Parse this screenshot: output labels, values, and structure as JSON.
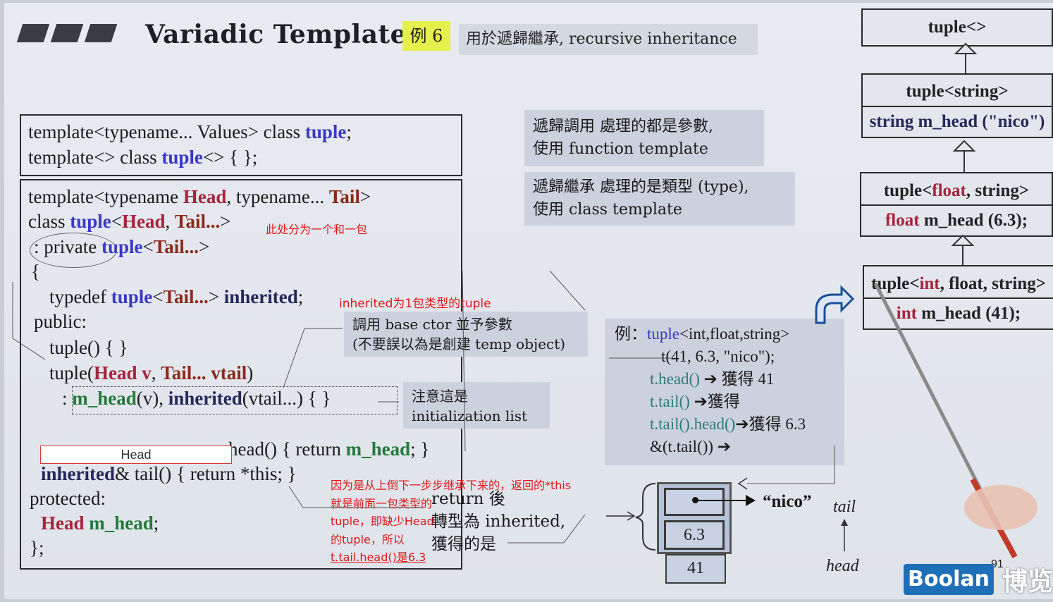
{
  "header": {
    "title": "Variadic Templates",
    "example_tag": "例 6",
    "subtitle": "用於遞歸繼承, recursive inheritance"
  },
  "code_top": {
    "line1": {
      "a": "template<typename... Values> class ",
      "b": "tuple",
      "c": ";"
    },
    "line2": {
      "a": "template<> class ",
      "b": "tuple",
      "c": "<> { };"
    }
  },
  "code_main": {
    "l1": {
      "a": "template<typename ",
      "b": "Head",
      "c": ", typename... ",
      "d": "Tail",
      "e": ">"
    },
    "l2": {
      "a": "class ",
      "b": "tuple",
      "c": "<",
      "d": "Head",
      "e": ", ",
      "f": "Tail...",
      "g": ">"
    },
    "l3": {
      "a": ": private ",
      "b": "tuple",
      "c": "<",
      "d": "Tail...",
      "e": ">"
    },
    "l4": "{",
    "l5": {
      "a": "typedef ",
      "b": "tuple",
      "c": "<",
      "d": "Tail...",
      "e": "> ",
      "f": "inherited",
      "g": ";"
    },
    "l6": "public:",
    "l7": "tuple() { }",
    "l8": {
      "a": "tuple(",
      "b": "Head v",
      "c": ", ",
      "d": "Tail... vtail",
      "e": ")"
    },
    "l9": {
      "a": ": ",
      "b": "m_head",
      "c": "(v), ",
      "d": "inherited",
      "e": "(vtail...) { }"
    },
    "l10": {
      "a": "head() { return ",
      "b": "m_head",
      "c": "; }"
    },
    "l11": {
      "a": "inherited",
      "b": "& ",
      "c": "tail",
      "d": "() { return *this; }"
    },
    "l12": "protected:",
    "l13": {
      "a": "Head",
      "b": " m_head",
      "c": ";"
    },
    "l14": "};"
  },
  "overlay_head": "Head",
  "notes": {
    "split": "此处分为一个和一包",
    "inherited": "inherited为1包类型的tuple",
    "explain_lines": [
      "因为是从上倒下一步步继承下来的，返回的*this",
      "就是前面一包类型的",
      "tuple，即缺少Head",
      "的tuple，所以",
      "t.tail.head()是6.3"
    ]
  },
  "panels": {
    "recursive_call": [
      "遞歸調用 處理的都是參數,",
      "使用 function template"
    ],
    "recursive_inherit": [
      "遞歸繼承 處理的是類型 (type),",
      "使用 class template"
    ],
    "base_ctor": [
      "調用 base ctor 並予參數",
      "(不要誤以為是創建 temp object)"
    ],
    "init_list": [
      "注意這是",
      "initialization list"
    ],
    "return_note": [
      "return 後",
      "轉型為 inherited,",
      "獲得的是"
    ]
  },
  "example": {
    "label": "例：",
    "l1a": "tuple",
    "l1b": "<int,float,string>",
    "l2": "t(41, 6.3, \"nico\");",
    "l3a": "t.head()",
    "l3b": "➔ 獲得 41",
    "l4a": "t.tail()",
    "l4b": "➔獲得",
    "l5a": "t.tail().head()",
    "l5b": "➔獲得 6.3",
    "l6": "&(t.tail()) ➔"
  },
  "hierarchy": [
    {
      "name": "tuple<>"
    },
    {
      "name": "tuple<string>",
      "member": "string m_head (\"nico\")"
    },
    {
      "name_a": "tuple<",
      "name_b": "float",
      "name_c": ", string>",
      "member_a": "float",
      "member_b": " m_head (6.3);"
    },
    {
      "name_a": "tuple<",
      "name_b": "int",
      "name_c": ", float, string>",
      "member_a": "int",
      "member_b": " m_head (41);"
    }
  ],
  "memory": {
    "cells": [
      "",
      "6.3",
      "41"
    ],
    "nico": "“nico”",
    "tail_label": "tail",
    "head_label": "head"
  },
  "brand": {
    "logo": "Boolan",
    "cn": "博览",
    "page": "91"
  },
  "colors": {
    "keyword": "#3838c8",
    "head": "#a8243c",
    "note": "#e01818",
    "panel": "#ccd2dd",
    "highlight": "#e6f04a",
    "logo": "#1f6fb8"
  }
}
